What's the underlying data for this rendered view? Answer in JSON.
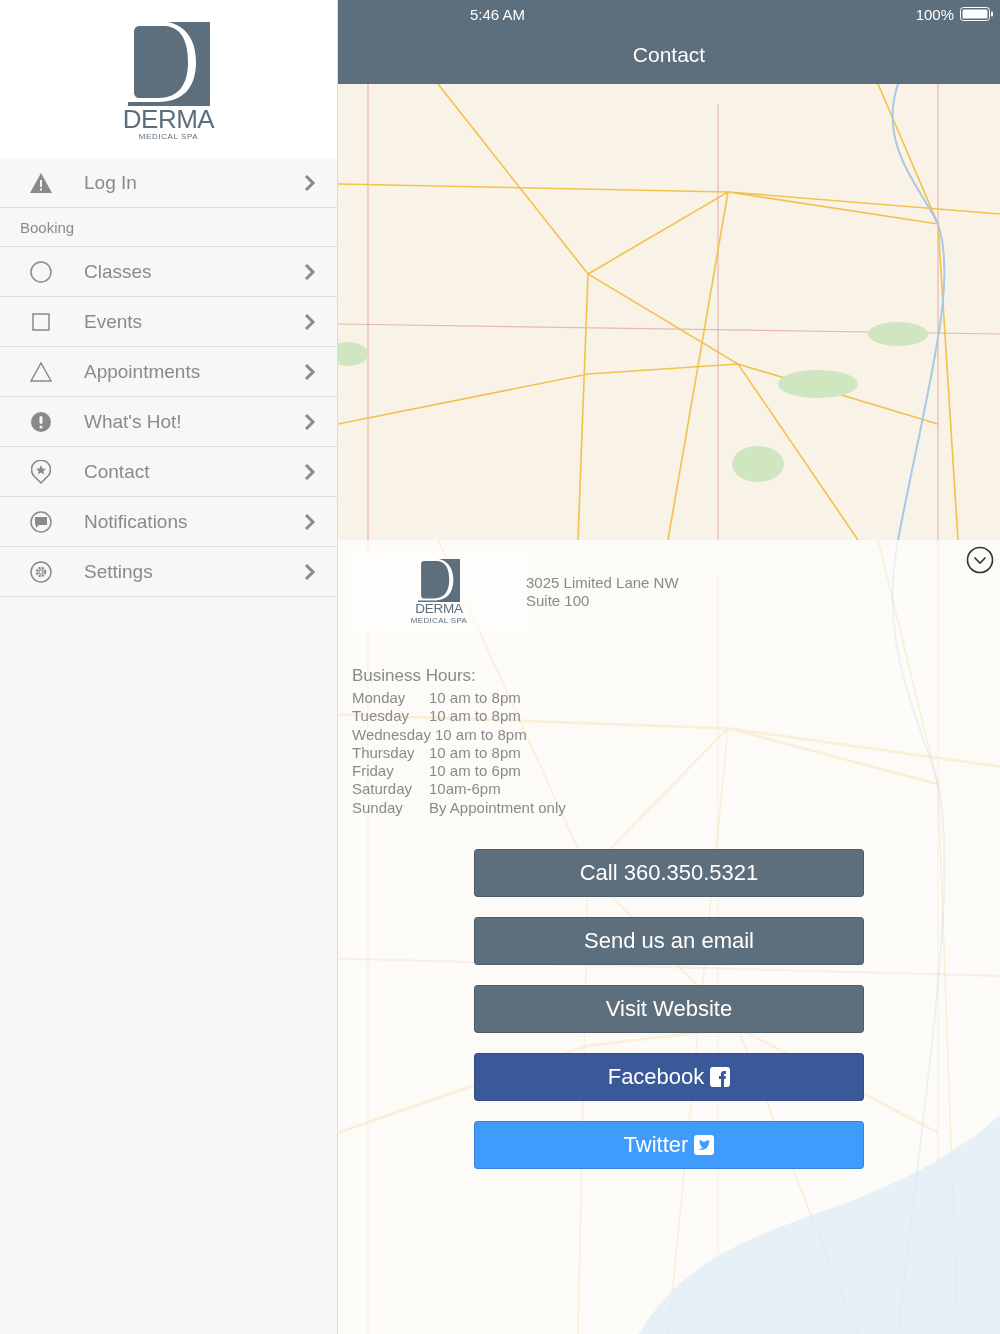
{
  "sidebar": {
    "logo": {
      "name": "DERMA",
      "tagline": "MEDICAL SPA"
    },
    "top_items": [
      {
        "label": "Log In"
      }
    ],
    "section": {
      "title": "Booking",
      "items": [
        {
          "label": "Classes"
        },
        {
          "label": "Events"
        },
        {
          "label": "Appointments"
        },
        {
          "label": "What's Hot!"
        },
        {
          "label": "Contact"
        },
        {
          "label": "Notifications"
        },
        {
          "label": "Settings"
        }
      ]
    }
  },
  "status_bar": {
    "time": "5:46 AM",
    "battery": "100%"
  },
  "nav_bar": {
    "title": "Contact"
  },
  "location_card": {
    "logo": {
      "name": "DERMA",
      "tagline": "MEDICAL SPA"
    },
    "address": [
      "3025 Limited Lane NW",
      "Suite 100"
    ]
  },
  "hours": {
    "title": "Business Hours:",
    "rows": [
      {
        "day": "Monday",
        "time": "10 am to 8pm"
      },
      {
        "day": "Tuesday",
        "time": "10 am to 8pm"
      },
      {
        "day": "Wednesday",
        "time": "10 am to 8pm"
      },
      {
        "day": "Thursday",
        "time": "10 am to 8pm"
      },
      {
        "day": "Friday",
        "time": "10 am to 6pm"
      },
      {
        "day": "Saturday",
        "time": "10am-6pm"
      },
      {
        "day": "Sunday",
        "time": "By Appointment only"
      }
    ]
  },
  "buttons": [
    {
      "label": "Call 360.350.5321",
      "kind": "plain"
    },
    {
      "label": "Send us an email",
      "kind": "plain"
    },
    {
      "label": "Visit Website",
      "kind": "plain"
    },
    {
      "label": "Facebook",
      "kind": "facebook"
    },
    {
      "label": "Twitter",
      "kind": "twitter"
    }
  ]
}
